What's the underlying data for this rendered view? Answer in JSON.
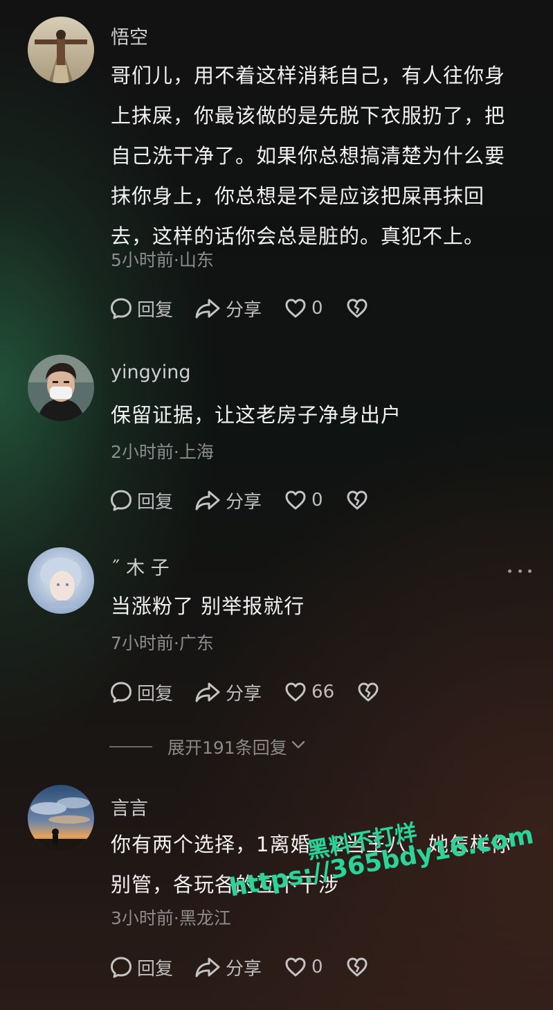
{
  "comments": [
    {
      "username": "悟空",
      "lines": [
        "哥们儿，用不着这样消耗自己，有人往你身",
        "上抹屎，你最该做的是先脱下衣服扔了，把",
        "自己洗干净了。如果你总想搞清楚为什么要",
        "抹你身上，你总想是不是应该把屎再抹回",
        "去，这样的话你会总是脏的。真犯不上。"
      ],
      "meta": "5小时前·山东",
      "reply_label": "回复",
      "share_label": "分享",
      "like_count": "0"
    },
    {
      "username": "yingying",
      "lines": [
        "保留证据，让这老房子净身出户"
      ],
      "meta": "2小时前·上海",
      "reply_label": "回复",
      "share_label": "分享",
      "like_count": "0"
    },
    {
      "username": "˝   木 子",
      "lines": [
        "当涨粉了    别举报就行"
      ],
      "meta": "7小时前·广东",
      "reply_label": "回复",
      "share_label": "分享",
      "like_count": "66",
      "expand_label": "展开191条回复"
    },
    {
      "username": "言言",
      "lines": [
        "你有两个选择，1离婚，2当王八，她怎样你",
        "别管，各玩各的互不干涉"
      ],
      "meta": "3小时前·黑龙江",
      "reply_label": "回复",
      "share_label": "分享",
      "like_count": "0"
    }
  ],
  "watermark": {
    "line1": "黑料不打烊",
    "line2": "https://365bdy16.com"
  },
  "icons": [
    "comment-bubble-icon",
    "share-arrow-icon",
    "heart-icon",
    "broken-heart-icon",
    "more-dots-icon",
    "chevron-down-icon"
  ],
  "colors": {
    "text_primary": "#f2f2f2",
    "text_secondary": "#8d8d8d",
    "watermark": "#2fd39a"
  }
}
